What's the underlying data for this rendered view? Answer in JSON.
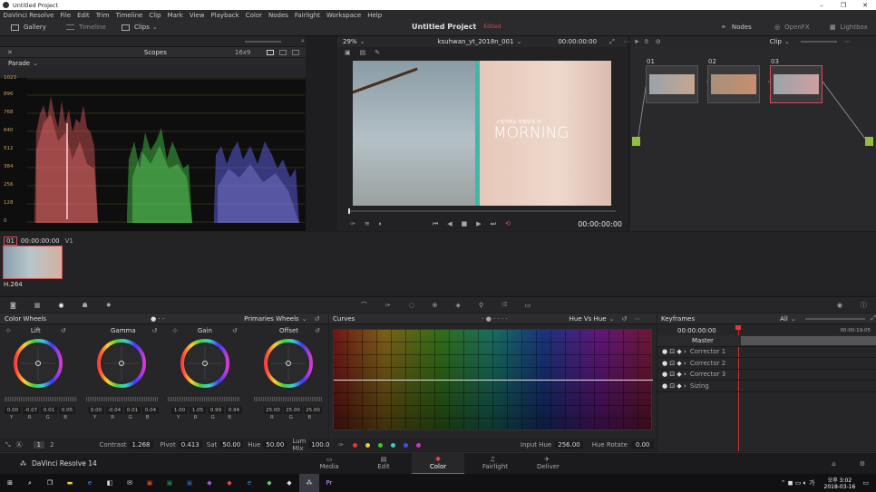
{
  "window": {
    "title": "Untitled Project",
    "controls": [
      "–",
      "❐",
      "✕"
    ]
  },
  "menu": [
    "DaVinci Resolve",
    "File",
    "Edit",
    "Trim",
    "Timeline",
    "Clip",
    "Mark",
    "View",
    "Playback",
    "Color",
    "Nodes",
    "Fairlight",
    "Workspace",
    "Help"
  ],
  "topbar": {
    "gallery": "Gallery",
    "timeline": "Timeline",
    "clips": "Clips",
    "project": "Untitled Project",
    "edited": "Edited",
    "nodes": "Nodes",
    "openfx": "OpenFX",
    "lightbox": "Lightbox"
  },
  "scopes": {
    "title": "Scopes",
    "aspect": "16x9",
    "mode": "Parade",
    "ticks": [
      "1023",
      "896",
      "768",
      "640",
      "512",
      "384",
      "256",
      "128",
      "0"
    ]
  },
  "viewer": {
    "zoom": "29%",
    "clip_name": "ksuhwan_yt_2018n_001",
    "timecode_top": "00:00:00:00",
    "timecode": "00:00:00:00",
    "overlay_small": "스밍지하는 비밀유의 더",
    "overlay_big": "MORNING"
  },
  "nodes": {
    "mode": "Clip",
    "labels": [
      "01",
      "02",
      "03"
    ]
  },
  "clips": {
    "index": "01",
    "timecode": "00:00:00:00",
    "track": "V1",
    "codec": "H.264"
  },
  "colorwheels": {
    "title": "Color Wheels",
    "mode": "Primaries Wheels",
    "wheels": [
      {
        "name": "Lift",
        "values": [
          "0.00",
          "-0.07",
          "0.01",
          "0.05"
        ]
      },
      {
        "name": "Gamma",
        "values": [
          "0.00",
          "-0.04",
          "0.01",
          "0.04"
        ]
      },
      {
        "name": "Gain",
        "values": [
          "1.00",
          "1.05",
          "0.99",
          "0.94"
        ]
      },
      {
        "name": "Offset",
        "values": [
          "25.00",
          "25.00",
          "25.00"
        ]
      }
    ],
    "ch4": [
      "Y",
      "R",
      "G",
      "B"
    ],
    "ch3": [
      "R",
      "G",
      "B"
    ],
    "footer": {
      "pages": [
        "1",
        "2"
      ],
      "contrast_label": "Contrast",
      "contrast": "1.268",
      "pivot_label": "Pivot",
      "pivot": "0.413",
      "sat_label": "Sat",
      "sat": "50.00",
      "hue_label": "Hue",
      "hue": "50.00",
      "lummix_label": "Lum Mix",
      "lummix": "100.00"
    }
  },
  "curves": {
    "title": "Curves",
    "mode": "Hue Vs Hue",
    "input_hue_label": "Input Hue",
    "input_hue": "256.00",
    "hue_rotate_label": "Hue Rotate",
    "hue_rotate": "0.00"
  },
  "keyframes": {
    "title": "Keyframes",
    "filter": "All",
    "tc_left": "00:00:00:00",
    "tc_right": "00:00:19:05",
    "master": "Master",
    "rows": [
      "Corrector 1",
      "Corrector 2",
      "Corrector 3",
      "Sizing"
    ]
  },
  "pages": [
    "Media",
    "Edit",
    "Color",
    "Fairlight",
    "Deliver"
  ],
  "app_name": "DaVinci Resolve 14",
  "clock": {
    "time": "오후 3:02",
    "date": "2018-03-16"
  },
  "colors": {
    "accent": "#e64b4b",
    "active": "#d1484e"
  }
}
